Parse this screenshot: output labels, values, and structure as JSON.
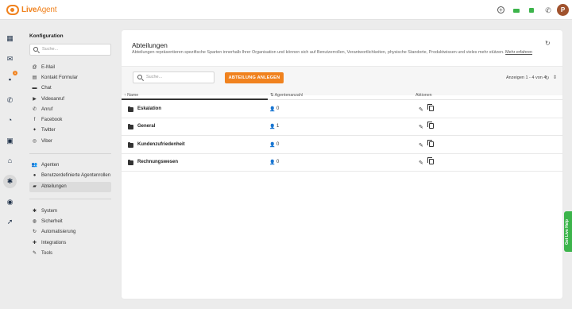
{
  "app": {
    "name_live": "Live",
    "name_agent": "Agent"
  },
  "topbar": {
    "icons": [
      "plus-circle-icon",
      "green-chat-icon",
      "green-status-icon",
      "phone-icon"
    ],
    "avatar_initial": "P"
  },
  "rail": {
    "items": [
      "dashboard-icon",
      "mail-icon",
      "chat-icon",
      "phone-icon",
      "reports-icon",
      "contacts-icon",
      "knowledgebase-icon",
      "settings-icon",
      "plugins-icon",
      "rocket-icon"
    ],
    "badge": "1"
  },
  "subnav": {
    "title": "Konfiguration",
    "search_placeholder": "Suche...",
    "channels": [
      {
        "label": "E-Mail",
        "icon": "at-icon"
      },
      {
        "label": "Kontakt Formular",
        "icon": "form-icon"
      },
      {
        "label": "Chat",
        "icon": "chat-icon"
      },
      {
        "label": "Videoanruf",
        "icon": "video-icon"
      },
      {
        "label": "Anruf",
        "icon": "phone-icon"
      },
      {
        "label": "Facebook",
        "icon": "facebook-icon"
      },
      {
        "label": "Twitter",
        "icon": "twitter-icon"
      },
      {
        "label": "Viber",
        "icon": "viber-icon"
      }
    ],
    "agents": [
      {
        "label": "Agenten",
        "icon": "users-icon"
      },
      {
        "label": "Benutzerdefinierte Agentenrollen",
        "icon": "user-role-icon"
      },
      {
        "label": "Abteilungen",
        "icon": "folder-icon"
      }
    ],
    "system": [
      {
        "label": "System",
        "icon": "gear-icon"
      },
      {
        "label": "Sicherheit",
        "icon": "shield-icon"
      },
      {
        "label": "Automatisierung",
        "icon": "automation-icon"
      },
      {
        "label": "Integrations",
        "icon": "puzzle-icon"
      },
      {
        "label": "Tools",
        "icon": "wrench-icon"
      }
    ]
  },
  "main": {
    "title": "Abteilungen",
    "description": "Abteilungen repräsentieren spezifische Sparten innerhalb Ihrer Organisation und können sich auf Benutzerrollen, Verantwortlichkeiten, physische Standorte, Produktwissen und vieles mehr stützen.",
    "more_link": "Mehr erfahren",
    "search_placeholder": "Suche...",
    "create_button": "ABTEILUNG ANLEGEN",
    "pager": "Anzeigen 1 - 4 von 4",
    "columns": {
      "name": "Name",
      "agents": "Agentenanzahl",
      "actions": "Aktionen"
    },
    "rows": [
      {
        "name": "Eskalation",
        "agents": "0"
      },
      {
        "name": "General",
        "agents": "1"
      },
      {
        "name": "Kundenzufriedenheit",
        "agents": "0"
      },
      {
        "name": "Rechnungswesen",
        "agents": "0"
      }
    ]
  },
  "livehelp": {
    "label": "Get Live Help"
  },
  "colors": {
    "accent": "#f0821e",
    "livehelp": "#3cb44b",
    "avatar": "#a0522d"
  }
}
